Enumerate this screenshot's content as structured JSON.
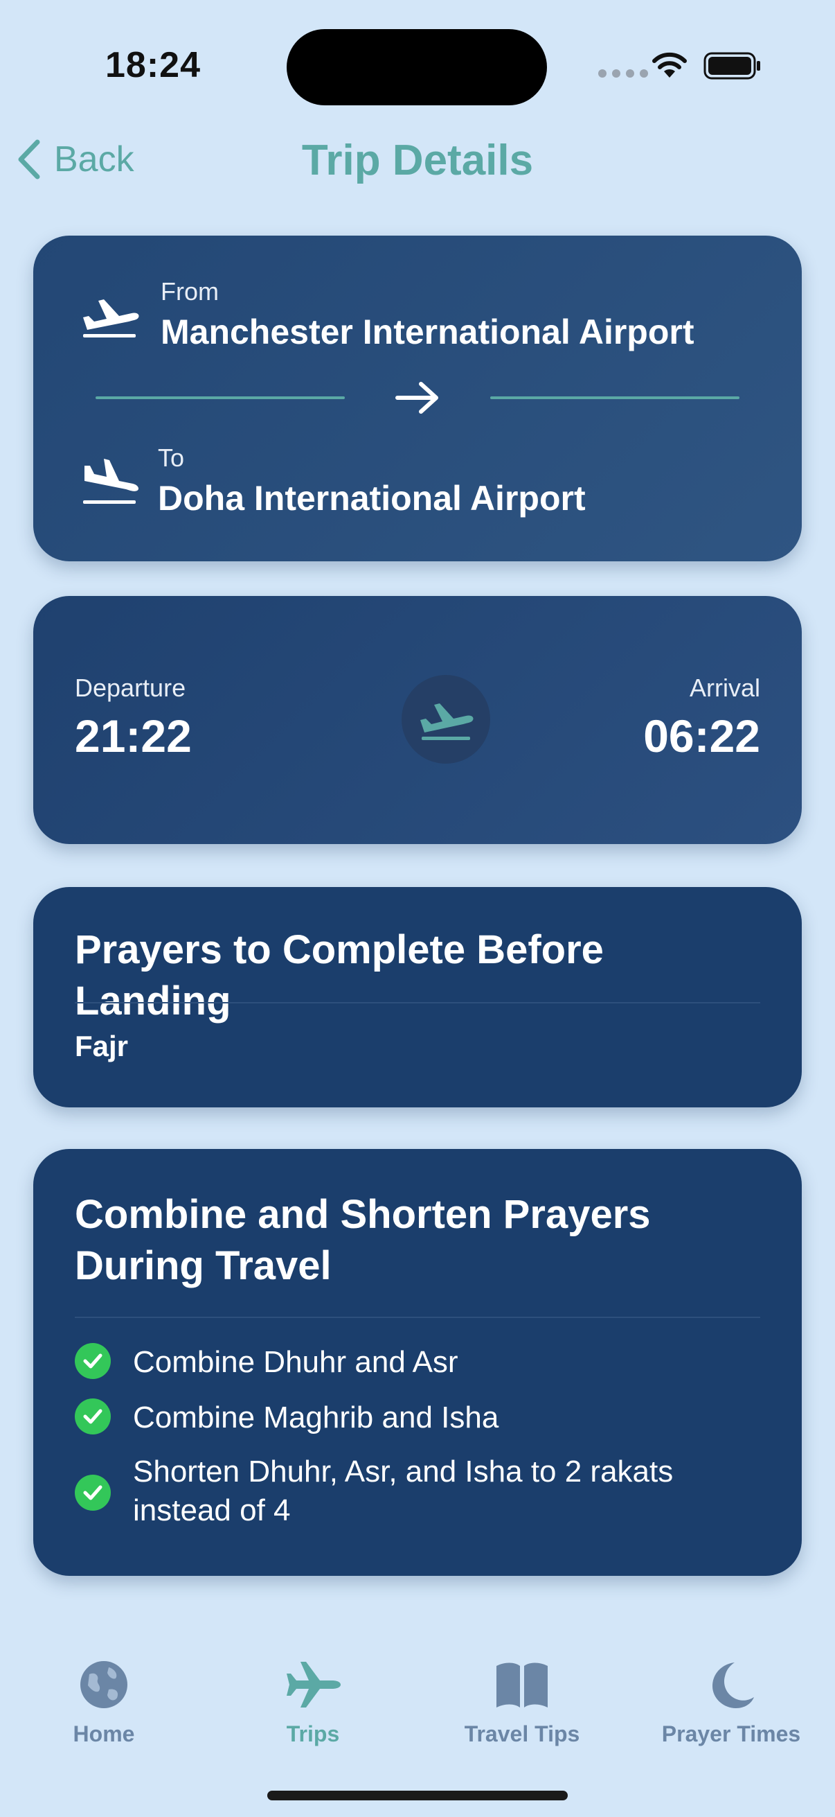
{
  "status_bar": {
    "time": "18:24"
  },
  "nav": {
    "back_label": "Back",
    "title": "Trip Details"
  },
  "route": {
    "from_label": "From",
    "from_airport": "Manchester International Airport",
    "to_label": "To",
    "to_airport": "Doha International Airport",
    "icons": {
      "departure": "plane-departure-icon",
      "arrival": "plane-arrival-icon",
      "arrow": "arrow-right-icon"
    }
  },
  "times": {
    "departure_label": "Departure",
    "departure_time": "21:22",
    "arrival_label": "Arrival",
    "arrival_time": "06:22"
  },
  "prayers_before_landing": {
    "title": "Prayers to Complete Before Landing",
    "items": [
      "Fajr"
    ]
  },
  "combine_shorten": {
    "title": "Combine and Shorten Prayers During Travel",
    "items": [
      "Combine Dhuhr and Asr",
      "Combine Maghrib and Isha",
      "Shorten Dhuhr, Asr, and Isha to 2 rakats instead of 4"
    ]
  },
  "tab_bar": {
    "tabs": [
      {
        "label": "Home",
        "icon": "globe-icon"
      },
      {
        "label": "Trips",
        "icon": "airplane-icon",
        "active": true
      },
      {
        "label": "Travel Tips",
        "icon": "book-icon"
      },
      {
        "label": "Prayer Times",
        "icon": "moon-icon"
      }
    ]
  },
  "colors": {
    "background": "#d3e6f8",
    "card": "#1e3f6e",
    "accent": "#5ba9a5",
    "check": "#33c759",
    "tab_inactive": "#6b86a6"
  }
}
